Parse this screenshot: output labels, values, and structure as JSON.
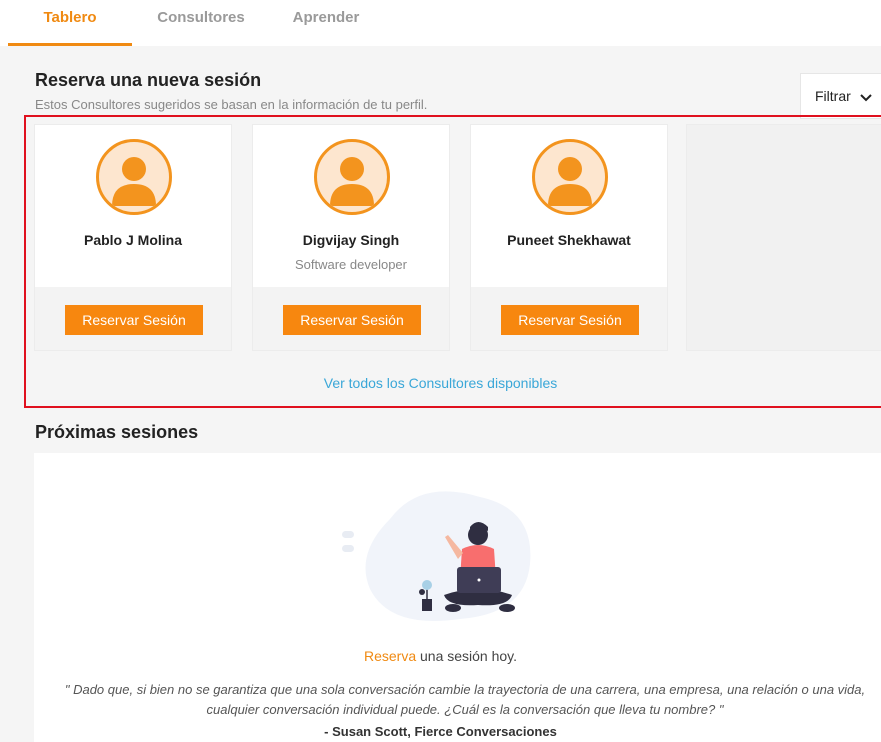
{
  "tabs": [
    {
      "label": "Tablero",
      "active": true
    },
    {
      "label": "Consultores",
      "active": false
    },
    {
      "label": "Aprender",
      "active": false
    }
  ],
  "booking": {
    "title": "Reserva una nueva sesión",
    "subtitle": "Estos Consultores sugeridos se basan en la información de tu perfil.",
    "filter_label": "Filtrar",
    "consultants": [
      {
        "name": "Pablo J Molina",
        "role": "",
        "button_label": "Reservar Sesión"
      },
      {
        "name": "Digvijay Singh",
        "role": "Software developer",
        "button_label": "Reservar Sesión"
      },
      {
        "name": "Puneet Shekhawat",
        "role": "",
        "button_label": "Reservar Sesión"
      }
    ],
    "view_all_label": "Ver todos los Consultores disponibles"
  },
  "upcoming": {
    "title": "Próximas sesiones",
    "cta_link": "Reserva",
    "cta_rest": " una sesión hoy.",
    "quote": "\" Dado que, si bien no se garantiza que una sola conversación cambie la trayectoria de una carrera, una empresa, una relación o una vida, cualquier conversación individual puede. ¿Cuál es la conversación que lleva tu nombre? \"",
    "author": "- Susan Scott, Fierce Conversaciones"
  },
  "colors": {
    "accent": "#f08a12",
    "button": "#f7870f",
    "link": "#3aa7d8",
    "highlight_border": "#e0101e"
  },
  "icons": {
    "avatar": "user-avatar-icon",
    "filter": "chevron-down-icon",
    "illustration": "person-with-laptop-illustration"
  }
}
